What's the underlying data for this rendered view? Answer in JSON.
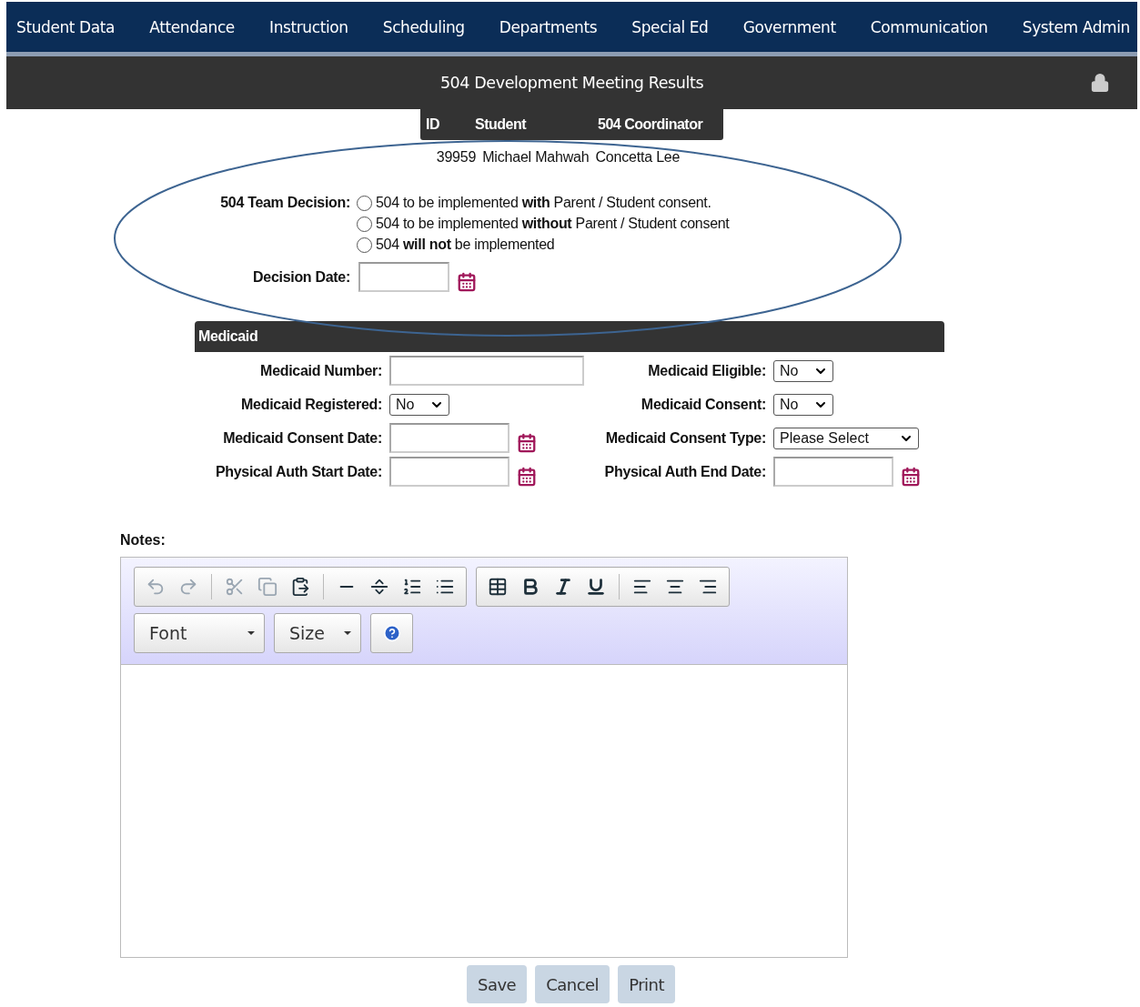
{
  "nav": {
    "items": [
      {
        "label": "Student Data"
      },
      {
        "label": "Attendance"
      },
      {
        "label": "Instruction"
      },
      {
        "label": "Scheduling"
      },
      {
        "label": "Departments"
      },
      {
        "label": "Special Ed"
      },
      {
        "label": "Government"
      },
      {
        "label": "Communication"
      },
      {
        "label": "System Admin"
      }
    ]
  },
  "title": "504 Development Meeting Results",
  "student_table": {
    "columns": [
      "ID",
      "Student",
      "504 Coordinator"
    ],
    "rows": [
      {
        "cells": [
          "39959",
          "Michael Mahwah",
          "Concetta Lee"
        ]
      }
    ]
  },
  "team_decision": {
    "label": "504 Team Decision:",
    "options": [
      {
        "label": "504 to be implemented **with** Parent / Student consent.",
        "selected": false
      },
      {
        "label": "504 to be implemented **without** Parent / Student consent",
        "selected": false
      },
      {
        "label": "504 **will not** be implemented",
        "selected": false
      }
    ]
  },
  "decision_date": {
    "label": "Decision Date:"
  },
  "medicaid": {
    "title": "Medicaid",
    "fields": [
      {
        "label": "Medicaid Number:",
        "kind": "text"
      },
      {
        "label": "Medicaid Eligible:",
        "kind": "select",
        "value": "No"
      },
      {
        "label": "Medicaid Registered:",
        "kind": "select",
        "value": "No"
      },
      {
        "label": "Medicaid Consent:",
        "kind": "select",
        "value": "No"
      },
      {
        "label": "Medicaid Consent Date:",
        "kind": "date"
      },
      {
        "label": "Medicaid Consent Type:",
        "kind": "select",
        "value": "Please Select"
      },
      {
        "label": "Physical Auth Start Date:",
        "kind": "date"
      },
      {
        "label": "Physical Auth End Date:",
        "kind": "date"
      }
    ]
  },
  "notes": {
    "label": "Notes:",
    "toolbar": {
      "groups": [
        {
          "buttons": [
            {
              "kind": "undo",
              "disabled": true
            },
            {
              "kind": "redo",
              "disabled": true
            },
            {
              "kind": "sep"
            },
            {
              "kind": "cut",
              "disabled": true
            },
            {
              "kind": "copy",
              "disabled": true
            },
            {
              "kind": "paste",
              "disabled": false
            },
            {
              "kind": "sep"
            },
            {
              "kind": "rule",
              "disabled": false
            },
            {
              "kind": "pagebreak",
              "disabled": false
            },
            {
              "kind": "ordered-list",
              "disabled": false
            },
            {
              "kind": "bullet-list",
              "disabled": false
            }
          ]
        },
        {
          "buttons": [
            {
              "kind": "table",
              "disabled": false
            },
            {
              "kind": "bold",
              "disabled": false
            },
            {
              "kind": "italic",
              "disabled": false
            },
            {
              "kind": "underline",
              "disabled": false
            },
            {
              "kind": "sep"
            },
            {
              "kind": "align-left",
              "disabled": false
            },
            {
              "kind": "align-center",
              "disabled": false
            },
            {
              "kind": "align-right",
              "disabled": false
            }
          ]
        }
      ],
      "dropdowns": [
        {
          "label": "Font"
        },
        {
          "label": "Size"
        }
      ]
    }
  },
  "buttons": [
    {
      "label": "Save"
    },
    {
      "label": "Cancel"
    },
    {
      "label": "Print"
    }
  ]
}
